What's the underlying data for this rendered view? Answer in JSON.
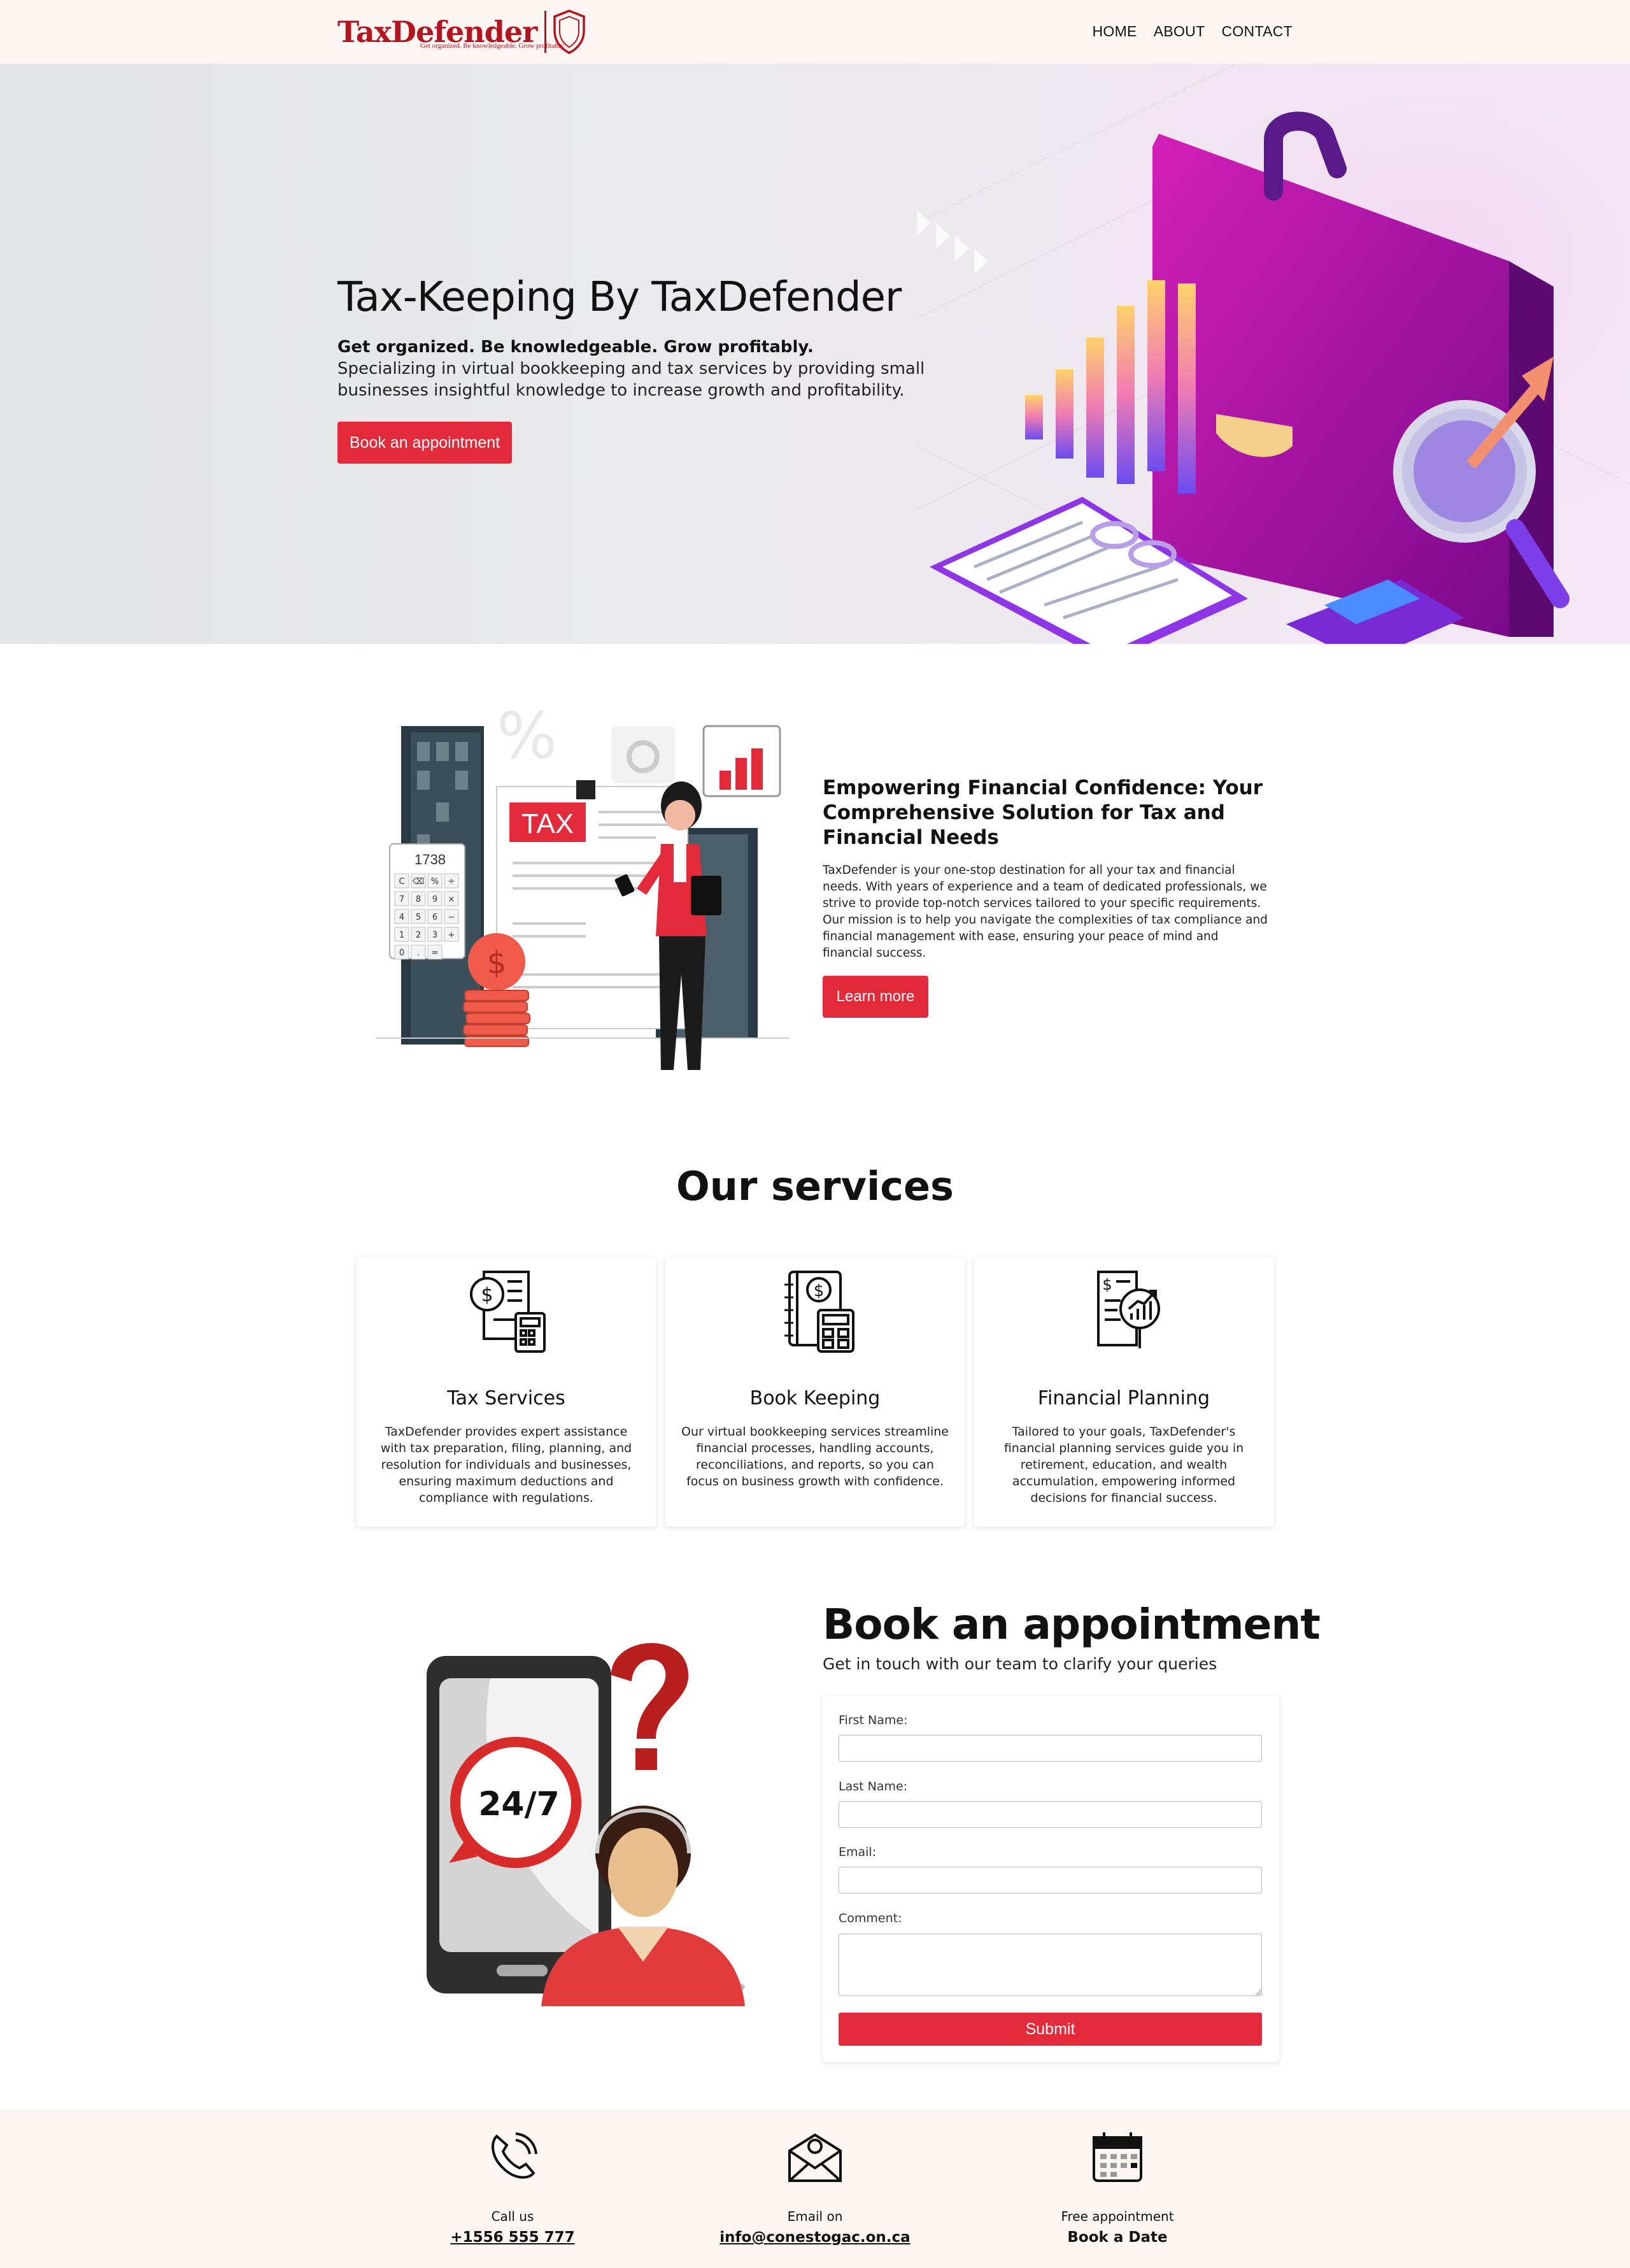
{
  "brand": {
    "name": "TaxDefender",
    "tagline": "Get organized. Be knowledgeable. Grow profitably."
  },
  "nav": [
    {
      "label": "HOME"
    },
    {
      "label": "ABOUT"
    },
    {
      "label": "CONTACT"
    }
  ],
  "hero": {
    "title": "Tax-Keeping By TaxDefender",
    "subtitle": "Get organized. Be knowledgeable. Grow profitably.",
    "description": "Specializing in virtual bookkeeping and tax services by providing small businesses insightful knowledge to increase growth and profitability.",
    "button": "Book an appointment"
  },
  "about": {
    "title": "Empowering Financial Confidence: Your Comprehensive Solution for Tax and Financial Needs",
    "text": "TaxDefender is your one-stop destination for all your tax and financial needs. With years of experience and a team of dedicated professionals, we strive to provide top-notch services tailored to your specific requirements. Our mission is to help you navigate the complexities of tax compliance and financial management with ease, ensuring your peace of mind and financial success.",
    "button": "Learn more",
    "illustration": {
      "badge": "TAX",
      "calc_display": "1738",
      "calc_keys": [
        "C",
        "⌫",
        "%",
        "÷",
        "7",
        "8",
        "9",
        "×",
        "4",
        "5",
        "6",
        "−",
        "1",
        "2",
        "3",
        "+",
        "0",
        ".",
        "="
      ]
    }
  },
  "services": {
    "title": "Our services",
    "items": [
      {
        "title": "Tax Services",
        "text": "TaxDefender provides expert assistance with tax preparation, filing, planning, and resolution for individuals and businesses, ensuring maximum deductions and compliance with regulations.",
        "icon": "tax-document-calculator-icon"
      },
      {
        "title": "Book Keeping",
        "text": "Our virtual bookkeeping services streamline financial processes, handling accounts, reconciliations, and reports, so you can focus on business growth with confidence.",
        "icon": "ledger-calculator-icon"
      },
      {
        "title": "Financial Planning",
        "text": "Tailored to your goals, TaxDefender's financial planning services guide you in retirement, education, and wealth accumulation, empowering informed decisions for financial success.",
        "icon": "financial-report-growth-icon"
      }
    ]
  },
  "appointment": {
    "title": "Book an appointment",
    "subtitle": "Get in touch with our team to clarify your queries",
    "illustration_badge": "24/7",
    "fields": [
      {
        "label": "First Name:",
        "value": ""
      },
      {
        "label": "Last Name:",
        "value": ""
      },
      {
        "label": "Email:",
        "value": ""
      },
      {
        "label": "Comment:",
        "value": ""
      }
    ],
    "submit": "Submit"
  },
  "footer": {
    "call": {
      "label": "Call us",
      "value": "+1556 555 777",
      "icon": "phone-icon"
    },
    "email": {
      "label": "Email on",
      "value": "info@conestogac.on.ca",
      "icon": "envelope-icon"
    },
    "book": {
      "label": "Free appointment",
      "value": "Book a Date",
      "icon": "calendar-icon"
    }
  },
  "colors": {
    "accent": "#e22a3b",
    "brand": "#b3141f",
    "header_bg": "#fdf6f3"
  }
}
